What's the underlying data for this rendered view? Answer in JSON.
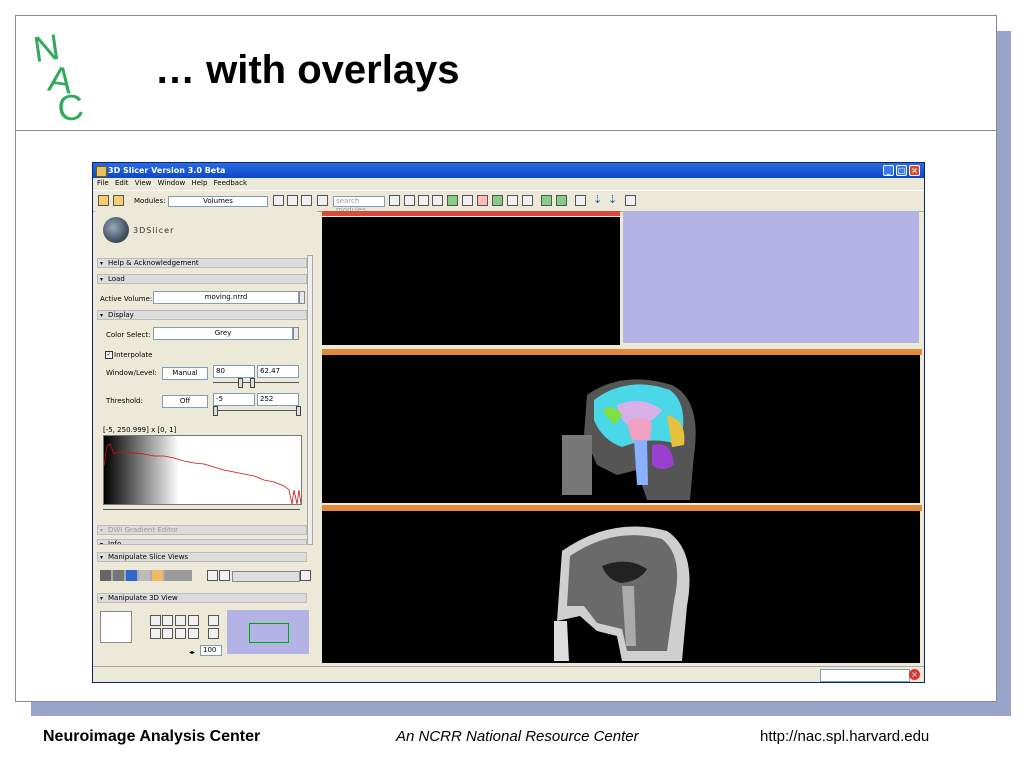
{
  "slide": {
    "title": "… with overlays",
    "footer_left": "Neuroimage Analysis Center",
    "footer_mid": "An NCRR National Resource Center",
    "footer_right": "http://nac.spl.harvard.edu",
    "logo_letters": "NAC"
  },
  "window": {
    "title": "3D Slicer Version 3.0 Beta",
    "menu": [
      "File",
      "Edit",
      "View",
      "Window",
      "Help",
      "Feedback"
    ],
    "modules_label": "Modules:",
    "module_selected": "Volumes",
    "search_placeholder": "search modules"
  },
  "panel": {
    "app_name": "3DSlicer",
    "sections": {
      "help": "Help & Acknowledgement",
      "load": "Load",
      "display": "Display",
      "dwi": "DWI Gradient Editor",
      "info": "Info",
      "manip_slice": "Manipulate Slice Views",
      "manip_3d": "Manipulate 3D View"
    },
    "active_volume_label": "Active Volume:",
    "active_volume": "moving.nrrd",
    "color_select_label": "Color Select:",
    "color_select": "Grey",
    "interpolate_label": "Interpolate",
    "window_level_label": "Window/Level:",
    "window_level_mode": "Manual",
    "window_value": "80",
    "level_value": "62.47",
    "threshold_label": "Threshold:",
    "threshold_mode": "Off",
    "threshold_low": "-5",
    "threshold_high": "252",
    "histogram_range": "[-5, 250.999] x [0, 1]",
    "zoom_value": "100"
  }
}
